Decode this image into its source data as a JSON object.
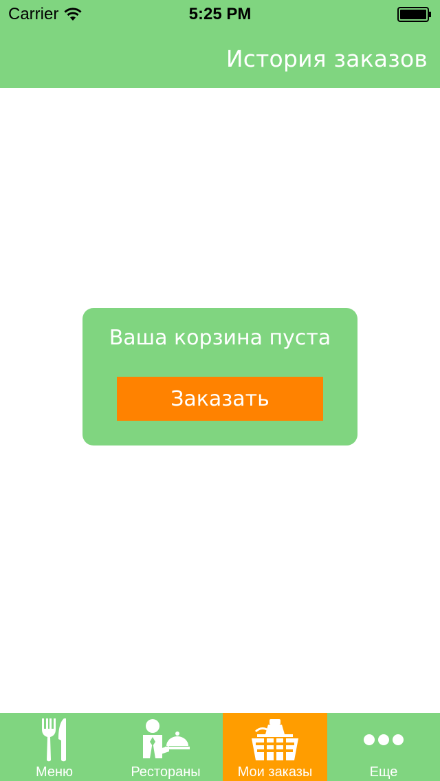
{
  "status_bar": {
    "carrier": "Carrier",
    "time": "5:25 PM"
  },
  "nav": {
    "title": "История заказов"
  },
  "empty_cart": {
    "message": "Ваша корзина пуста",
    "button_label": "Заказать"
  },
  "tabs": [
    {
      "label": "Меню",
      "icon": "fork-knife-icon",
      "active": false
    },
    {
      "label": "Рестораны",
      "icon": "waiter-cloche-icon",
      "active": false
    },
    {
      "label": "Мои заказы",
      "icon": "basket-icon",
      "active": true
    },
    {
      "label": "Еще",
      "icon": "more-dots-icon",
      "active": false
    }
  ],
  "colors": {
    "brand_green": "#80d580",
    "button_orange": "#ff8200",
    "active_tab_orange": "#ff9d00",
    "text_white": "#ffffff"
  }
}
